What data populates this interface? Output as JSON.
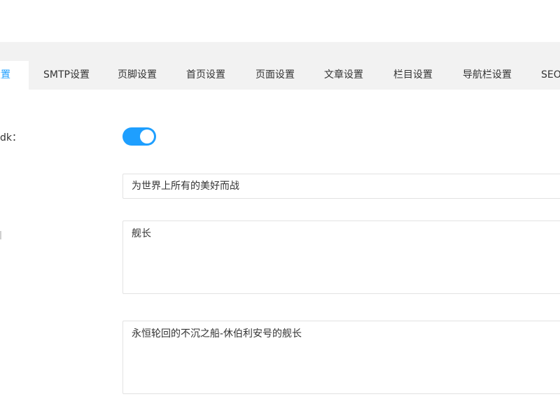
{
  "tabs": [
    {
      "label": "设置",
      "active": true
    },
    {
      "label": "SMTP设置"
    },
    {
      "label": "页脚设置"
    },
    {
      "label": "首页设置"
    },
    {
      "label": "页面设置"
    },
    {
      "label": "文章设置"
    },
    {
      "label": "栏目设置"
    },
    {
      "label": "导航栏设置"
    },
    {
      "label": "SEO"
    }
  ],
  "form": {
    "toggle_label": "dk：",
    "toggle_on": true,
    "input_value": "为世界上所有的美好而战",
    "textarea1_value": "舰长",
    "textarea2_value": "永恒轮回的不沉之船-休伯利安号的舰长"
  },
  "colors": {
    "accent": "#1e9fff",
    "tabbar_bg": "#f2f2f2",
    "border": "#e2e2e2"
  }
}
